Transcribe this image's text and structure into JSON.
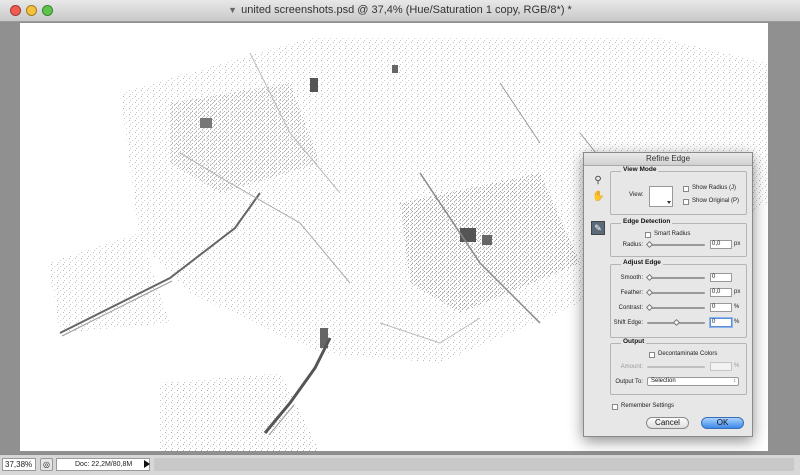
{
  "window": {
    "title": "united screenshots.psd @ 37,4% (Hue/Saturation 1 copy, RGB/8*) *",
    "doc_icon": "psd-file-icon"
  },
  "status_bar": {
    "zoom": "37,38%",
    "doc_info": "Doc: 22,2M/80,8M"
  },
  "dialog": {
    "title": "Refine Edge",
    "tools": [
      "zoom-tool-icon",
      "hand-tool-icon",
      "refine-radius-tool-icon"
    ],
    "view_mode": {
      "label": "View Mode",
      "view_label": "View:",
      "show_radius": "Show Radius (J)",
      "show_original": "Show Original (P)"
    },
    "edge_detection": {
      "label": "Edge Detection",
      "smart_radius": "Smart Radius",
      "radius_label": "Radius:",
      "radius_value": "0,0",
      "radius_unit": "px"
    },
    "adjust_edge": {
      "label": "Adjust Edge",
      "smooth_label": "Smooth:",
      "smooth_value": "0",
      "feather_label": "Feather:",
      "feather_value": "0,0",
      "feather_unit": "px",
      "contrast_label": "Contrast:",
      "contrast_value": "0",
      "contrast_unit": "%",
      "shift_label": "Shift Edge:",
      "shift_value": "0",
      "shift_unit": "%",
      "shift_slider_level": 0.5
    },
    "output": {
      "label": "Output",
      "decontaminate": "Decontaminate Colors",
      "amount_label": "Amount:",
      "amount_unit": "%",
      "output_to_label": "Output To:",
      "output_to_value": "Selection"
    },
    "remember": "Remember Settings",
    "cancel": "Cancel",
    "ok": "OK"
  }
}
